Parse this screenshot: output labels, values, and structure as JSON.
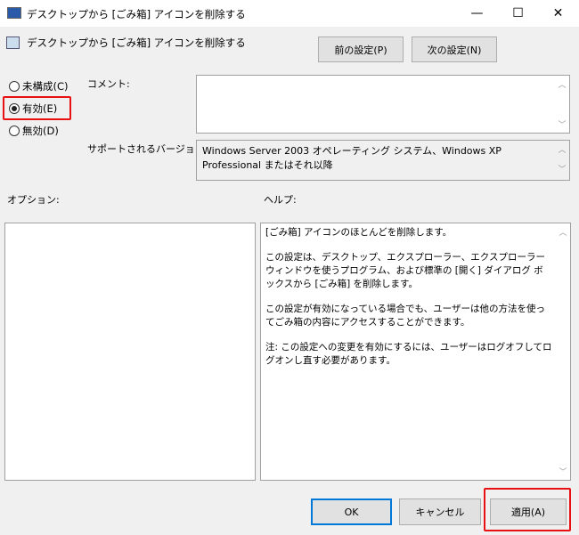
{
  "window": {
    "title": "デスクトップから [ごみ箱] アイコンを削除する",
    "minimize": "—",
    "maximize": "☐",
    "close": "✕"
  },
  "header": {
    "title": "デスクトップから [ごみ箱] アイコンを削除する",
    "prev": "前の設定(P)",
    "next": "次の設定(N)"
  },
  "state": {
    "options": [
      {
        "label": "未構成(C)",
        "selected": false
      },
      {
        "label": "有効(E)",
        "selected": true
      },
      {
        "label": "無効(D)",
        "selected": false
      }
    ]
  },
  "comment": {
    "label": "コメント:",
    "value": ""
  },
  "supported": {
    "label": "サポートされるバージョン:",
    "value": "Windows Server 2003 オペレーティング システム、Windows XP Professional またはそれ以降"
  },
  "options_label": "オプション:",
  "help": {
    "label": "ヘルプ:",
    "paragraphs": [
      "[ごみ箱] アイコンのほとんどを削除します。",
      "この設定は、デスクトップ、エクスプローラー、エクスプローラー ウィンドウを使うプログラム、および標準の [開く] ダイアログ ボックスから [ごみ箱] を削除します。",
      "この設定が有効になっている場合でも、ユーザーは他の方法を使ってごみ箱の内容にアクセスすることができます。",
      "注: この設定への変更を有効にするには、ユーザーはログオフしてログオンし直す必要があります。"
    ]
  },
  "footer": {
    "ok": "OK",
    "cancel": "キャンセル",
    "apply": "適用(A)"
  }
}
